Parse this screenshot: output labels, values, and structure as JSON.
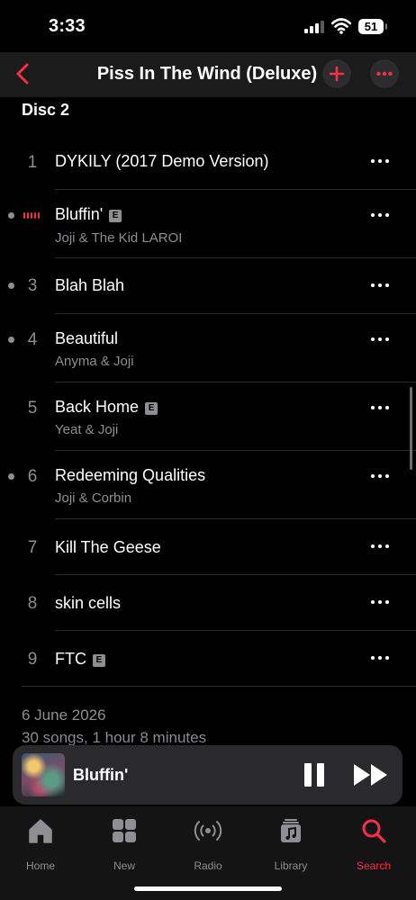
{
  "status": {
    "time": "3:33",
    "battery": "51"
  },
  "nav": {
    "title": "Piss In The Wind (Deluxe)"
  },
  "disc_label": "Disc 2",
  "tracks": [
    {
      "number": "1",
      "title": "DYKILY (2017 Demo Version)",
      "artist": ""
    },
    {
      "number": "2",
      "title": "Bluffin'",
      "artist": "Joji & The Kid LAROI",
      "explicit": "E",
      "playing": true
    },
    {
      "number": "3",
      "title": "Blah Blah",
      "artist": ""
    },
    {
      "number": "4",
      "title": "Beautiful",
      "artist": "Anyma & Joji"
    },
    {
      "number": "5",
      "title": "Back Home",
      "artist": "Yeat & Joji",
      "explicit": "E"
    },
    {
      "number": "6",
      "title": "Redeeming Qualities",
      "artist": "Joji & Corbin"
    },
    {
      "number": "7",
      "title": "Kill The Geese",
      "artist": ""
    },
    {
      "number": "8",
      "title": "skin cells",
      "artist": ""
    },
    {
      "number": "9",
      "title": "FTC",
      "artist": "",
      "explicit": "E"
    }
  ],
  "album_info": {
    "release_date": "6 June 2026",
    "song_count": "30 songs, 1 hour 8 minutes"
  },
  "mini_player": {
    "title": "Bluffin'"
  },
  "tabs": [
    {
      "label": "Home",
      "icon": "home-icon"
    },
    {
      "label": "New",
      "icon": "grid-icon"
    },
    {
      "label": "Radio",
      "icon": "radio-icon"
    },
    {
      "label": "Library",
      "icon": "library-icon"
    },
    {
      "label": "Search",
      "icon": "search-icon",
      "active": true
    }
  ],
  "colors": {
    "accent": "#fa2d48",
    "background": "#000000",
    "secondary_text": "#8e8e93"
  }
}
